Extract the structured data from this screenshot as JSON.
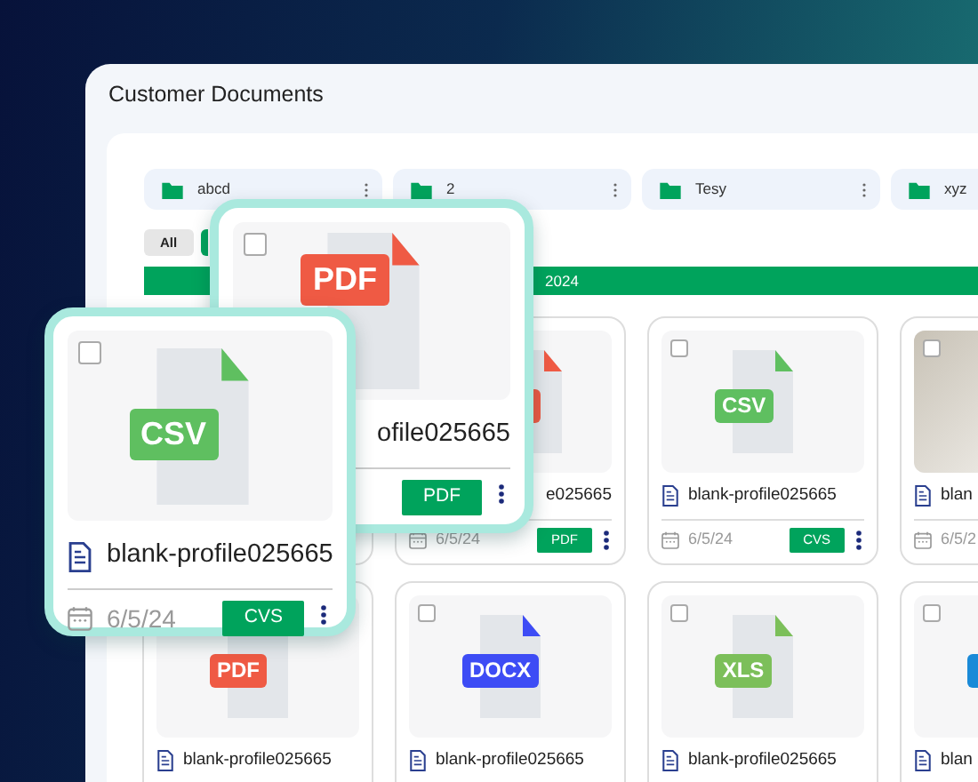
{
  "window": {
    "title": "Customer Documents"
  },
  "folders": [
    {
      "name": "abcd"
    },
    {
      "name": "2"
    },
    {
      "name": "Tesy"
    },
    {
      "name": "xyz"
    }
  ],
  "filters": [
    {
      "label": "All",
      "selected": false
    },
    {
      "selected": true
    }
  ],
  "year_bar": {
    "label": "2024"
  },
  "grid": {
    "rows": [
      [
        {
          "kind": "covered"
        },
        {
          "kind": "file",
          "color": "#ef5a44",
          "clipped": true,
          "name": "e025665",
          "date": "6/5/24",
          "tag": "PDF"
        },
        {
          "kind": "file",
          "color": "#5fbf60",
          "label": "CSV",
          "checked": false,
          "name": "blank-profile025665",
          "date": "6/5/24",
          "tag": "CVS"
        },
        {
          "kind": "photo",
          "checked": false,
          "name": "blan",
          "date": "6/5/2"
        }
      ],
      [
        {
          "kind": "file",
          "color": "#ef5a44",
          "label": "PDF",
          "name": "blank-profile025665"
        },
        {
          "kind": "file",
          "color": "#3d4cf5",
          "label": "DOCX",
          "checked": false,
          "name": "blank-profile025665"
        },
        {
          "kind": "file",
          "color": "#7cbf5a",
          "label": "XLS",
          "checked": false,
          "name": "blank-profile025665"
        },
        {
          "kind": "file",
          "color": "#1a8ad8",
          "checked": false,
          "name": "blan"
        }
      ]
    ]
  },
  "highlight_cards": [
    {
      "kind": "file",
      "color": "#ef5a44",
      "label": "PDF",
      "checked": false,
      "clipped": true,
      "name": "ofile025665",
      "tag": "PDF"
    },
    {
      "kind": "file",
      "color": "#5fbf60",
      "label": "CSV",
      "checked": false,
      "name": "blank-profile025665",
      "date": "6/5/24",
      "tag": "CVS"
    }
  ]
}
